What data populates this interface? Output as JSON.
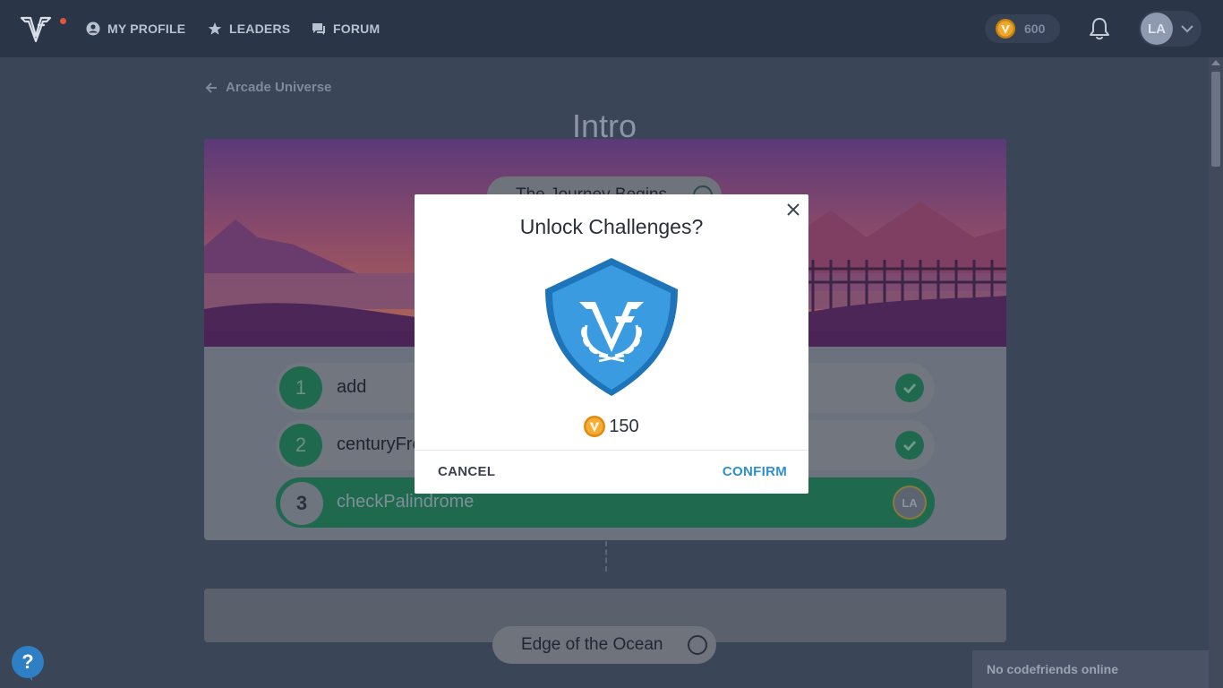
{
  "nav": {
    "items": [
      {
        "label": "MY PROFILE",
        "icon": "user-circle-icon"
      },
      {
        "label": "LEADERS",
        "icon": "star-icon"
      },
      {
        "label": "FORUM",
        "icon": "chat-icon"
      }
    ],
    "coins": "600",
    "user_initials": "LA"
  },
  "page": {
    "back_label": "Arcade Universe",
    "title": "Intro"
  },
  "sections": [
    {
      "name": "The Journey Begins"
    },
    {
      "name": "Edge of the Ocean"
    }
  ],
  "tasks": [
    {
      "number": "1",
      "name": "add",
      "status": "solved"
    },
    {
      "number": "2",
      "name": "centuryFromYear",
      "status": "solved"
    },
    {
      "number": "3",
      "name": "checkPalindrome",
      "status": "current",
      "avatar": "LA"
    }
  ],
  "modal": {
    "title": "Unlock Challenges?",
    "cost": "150",
    "cancel_label": "CANCEL",
    "confirm_label": "CONFIRM"
  },
  "help_label": "?",
  "friends_status": "No codefriends online",
  "colors": {
    "accent": "#2d8fd0",
    "success": "#1f6a4f",
    "coin": "#f5a623",
    "nav_bg": "#2b3548"
  }
}
